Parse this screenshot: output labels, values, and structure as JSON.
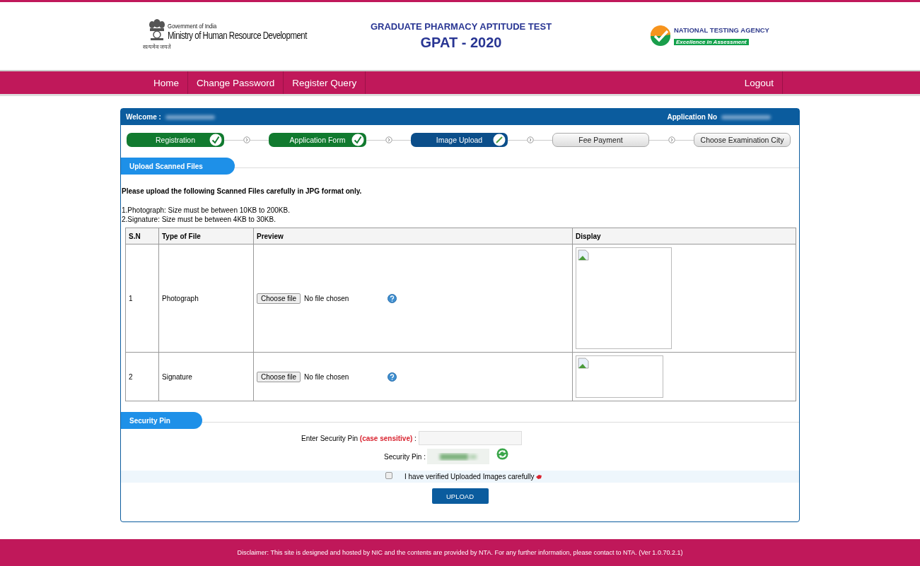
{
  "header": {
    "ministry": {
      "line1": "Government of India",
      "line2": "Ministry of Human Resource Development",
      "motto": "सत्यमेव जयते"
    },
    "exam_subtitle": "GRADUATE PHARMACY APTITUDE TEST",
    "exam_title": "GPAT - 2020",
    "agency": {
      "name": "NATIONAL TESTING AGENCY",
      "tagline": "Excellence in Assessment"
    }
  },
  "nav": {
    "left": [
      {
        "label": "Home"
      },
      {
        "label": "Change Password"
      },
      {
        "label": "Register Query"
      }
    ],
    "right": [
      {
        "label": "Logout"
      }
    ]
  },
  "panel": {
    "welcome_label": "Welcome :",
    "application_label": "Application No"
  },
  "steps": [
    {
      "label": "Registration",
      "kind": "done"
    },
    {
      "label": "Application Form",
      "kind": "done"
    },
    {
      "label": "Image Upload",
      "kind": "current"
    },
    {
      "label": "Fee Payment",
      "kind": "pending"
    },
    {
      "label": "Choose Examination City",
      "kind": "pending"
    }
  ],
  "upload_section": {
    "title": "Upload Scanned Files",
    "instruction": "Please upload the following Scanned Files carefully in JPG format only.",
    "notes": [
      "1.Photograph: Size must be between 10KB to 200KB.",
      "2.Signature: Size must be between 4KB to 30KB."
    ]
  },
  "table": {
    "columns": [
      "S.N",
      "Type of File",
      "Preview",
      "Display"
    ],
    "rows": [
      {
        "sn": "1",
        "type": "Photograph",
        "button": "Choose file",
        "status": "No file chosen",
        "kind": "tall"
      },
      {
        "sn": "2",
        "type": "Signature",
        "button": "Choose file",
        "status": "No file chosen",
        "kind": "wide"
      }
    ]
  },
  "security_section": {
    "title": "Security Pin",
    "pin_label": "Enter Security Pin",
    "pin_hint": "(case sensitive)",
    "pin_colon": ":",
    "captcha_label": "Security Pin :",
    "verify": {
      "label": "I have verified Uploaded Images carefully",
      "checked": false
    },
    "button": "UPLOAD"
  },
  "footer": "Disclaimer: This site is designed and hosted by NIC and the contents are provided by NTA. For any further information, please contact to NTA. (Ver 1.0.70.2.1)"
}
